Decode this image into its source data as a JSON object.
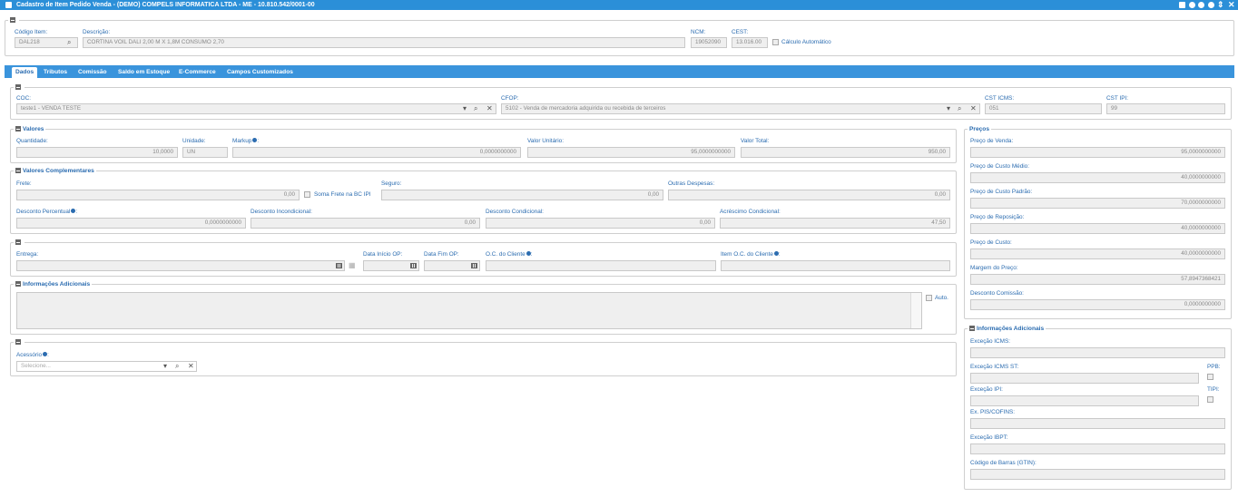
{
  "window": {
    "title": "Cadastro de Item Pedido Venda - (DEMO) COMPELS INFORMATICA LTDA - ME - 10.810.542/0001-00"
  },
  "item": {
    "codigo_label": "Código Item:",
    "codigo_value": "DAL218",
    "descricao_label": "Descrição:",
    "descricao_value": "CORTINA VOIL DALI 2,00 M X 1,8M CONSUMO 2,70",
    "ncm_label": "NCM:",
    "ncm_value": "19052090",
    "cest_label": "CEST:",
    "cest_value": "13.016.00",
    "calculo_label": "Cálculo Automático"
  },
  "tabs": [
    "Dados",
    "Tributos",
    "Comissão",
    "Saldo em Estoque",
    "E-Commerce",
    "Campos Customizados"
  ],
  "coc": {
    "coc_label": "COC:",
    "coc_value": "teste1 - VENDA TESTE",
    "cfop_label": "CFOP:",
    "cfop_value": "5102 - Venda de mercadoria adquirida ou recebida de terceiros",
    "cst_icms_label": "CST ICMS:",
    "cst_icms_value": "051",
    "cst_ipi_label": "CST IPI:",
    "cst_ipi_value": "99"
  },
  "valores": {
    "legend": "Valores",
    "quantidade_label": "Quantidade:",
    "quantidade_value": "10,0000",
    "unidade_label": "Unidade:",
    "unidade_value": "UN",
    "markup_label": "Markup",
    "markup_value": "0,0000000000",
    "unitario_label": "Valor Unitário:",
    "unitario_value": "95,0000000000",
    "total_label": "Valor Total:",
    "total_value": "950,00"
  },
  "complementares": {
    "legend": "Valores Complementares",
    "frete_label": "Frete:",
    "frete_value": "0,00",
    "soma_frete_label": "Soma Frete na BC IPI",
    "seguro_label": "Seguro:",
    "seguro_value": "0,00",
    "outras_label": "Outras Despesas:",
    "outras_value": "0,00",
    "desc_perc_label": "Desconto Percentual",
    "desc_perc_value": "0,0000000000",
    "desc_incond_label": "Desconto Incondicional:",
    "desc_incond_value": "0,00",
    "desc_cond_label": "Desconto Condicional:",
    "desc_cond_value": "0,00",
    "acrescimo_label": "Acréscimo Condicional:",
    "acrescimo_value": "47,50"
  },
  "entrega": {
    "entrega_label": "Entrega:",
    "data_inicio_label": "Data Início OP:",
    "data_fim_label": "Data Fim OP:",
    "oc_cliente_label": "O.C. do Cliente",
    "item_oc_label": "Item O.C. do Cliente"
  },
  "info": {
    "legend": "Informações Adicionais",
    "auto_label": "Auto."
  },
  "acessorio": {
    "label": "Acessório",
    "placeholder": "Selecione..."
  },
  "precos": {
    "legend": "Preços",
    "venda_label": "Preço de Venda:",
    "venda_value": "95,0000000000",
    "custo_medio_label": "Preço de Custo Médio:",
    "custo_medio_value": "40,0000000000",
    "custo_padrao_label": "Preço de Custo Padrão:",
    "custo_padrao_value": "70,0000000000",
    "reposicao_label": "Preço de Reposição:",
    "reposicao_value": "40,0000000000",
    "custo_label": "Preço de Custo:",
    "custo_value": "40,0000000000",
    "margem_label": "Margem do Preço:",
    "margem_value": "57,8947368421",
    "desc_comissao_label": "Desconto Comissão:",
    "desc_comissao_value": "0,0000000000"
  },
  "info_right": {
    "legend": "Informações Adicionais",
    "excecao_icms_label": "Exceção ICMS:",
    "excecao_icms_st_label": "Exceção ICMS ST:",
    "ppb_label": "PPB:",
    "excecao_ipi_label": "Exceção IPI:",
    "tipi_label": "TIPI:",
    "ex_pis_label": "Ex. PIS/COFINS:",
    "excecao_ibpt_label": "Exceção IBPT:",
    "codigo_barras_label": "Código de Barras (GTIN):"
  }
}
